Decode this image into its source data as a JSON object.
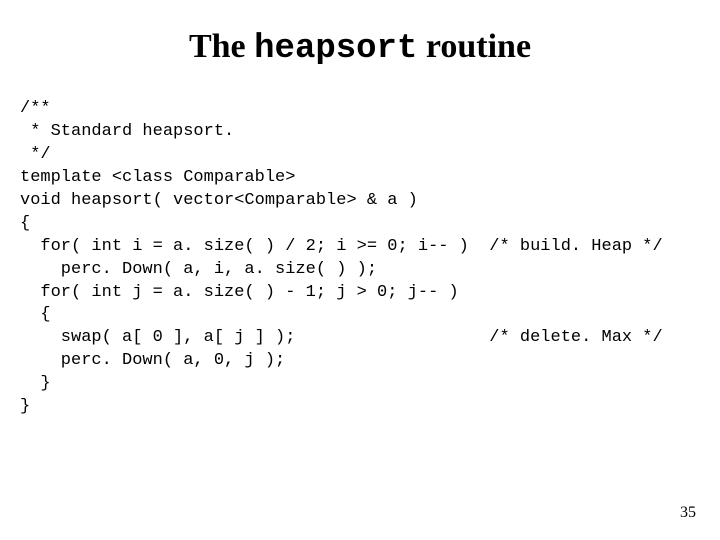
{
  "title": {
    "prefix": "The ",
    "mono": "heapsort",
    "suffix": " routine"
  },
  "code": {
    "lines": [
      "/**",
      " * Standard heapsort.",
      " */",
      "template <class Comparable>",
      "void heapsort( vector<Comparable> & a )",
      "{",
      "  for( int i = a. size( ) / 2; i >= 0; i-- )  /* build. Heap */",
      "    perc. Down( a, i, a. size( ) );",
      "  for( int j = a. size( ) - 1; j > 0; j-- )",
      "  {",
      "    swap( a[ 0 ], a[ j ] );                   /* delete. Max */",
      "    perc. Down( a, 0, j );",
      "  }",
      "}"
    ]
  },
  "page_number": "35"
}
